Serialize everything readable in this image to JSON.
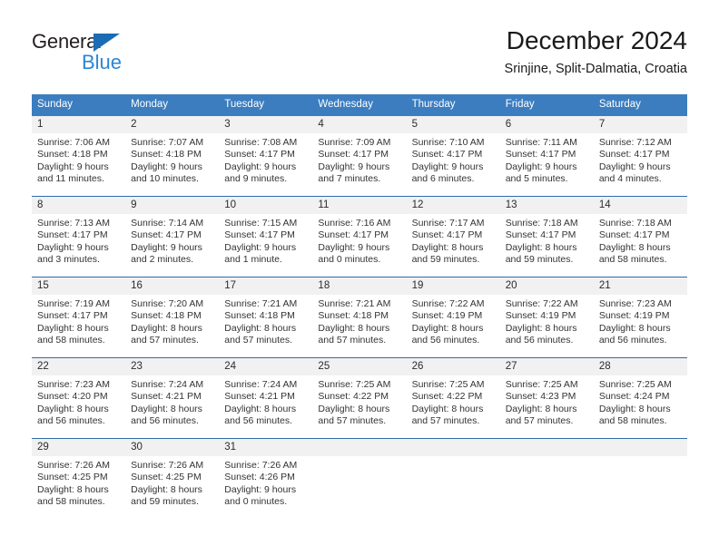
{
  "brand": {
    "name_part1": "General",
    "name_part2": "Blue",
    "accent_color": "#2986d6",
    "triangle_color": "#1b6cb5"
  },
  "header": {
    "title": "December 2024",
    "subtitle": "Srinjine, Split-Dalmatia, Croatia"
  },
  "theme": {
    "header_blue": "#3b7dbf",
    "separator_blue": "#2f6ca8",
    "day_band_gray": "#f1f1f1"
  },
  "weekdays": [
    {
      "label": "Sunday"
    },
    {
      "label": "Monday"
    },
    {
      "label": "Tuesday"
    },
    {
      "label": "Wednesday"
    },
    {
      "label": "Thursday"
    },
    {
      "label": "Friday"
    },
    {
      "label": "Saturday"
    }
  ],
  "weeks": [
    [
      {
        "day": "1",
        "sunrise": "Sunrise: 7:06 AM",
        "sunset": "Sunset: 4:18 PM",
        "daylight1": "Daylight: 9 hours",
        "daylight2": "and 11 minutes."
      },
      {
        "day": "2",
        "sunrise": "Sunrise: 7:07 AM",
        "sunset": "Sunset: 4:18 PM",
        "daylight1": "Daylight: 9 hours",
        "daylight2": "and 10 minutes."
      },
      {
        "day": "3",
        "sunrise": "Sunrise: 7:08 AM",
        "sunset": "Sunset: 4:17 PM",
        "daylight1": "Daylight: 9 hours",
        "daylight2": "and 9 minutes."
      },
      {
        "day": "4",
        "sunrise": "Sunrise: 7:09 AM",
        "sunset": "Sunset: 4:17 PM",
        "daylight1": "Daylight: 9 hours",
        "daylight2": "and 7 minutes."
      },
      {
        "day": "5",
        "sunrise": "Sunrise: 7:10 AM",
        "sunset": "Sunset: 4:17 PM",
        "daylight1": "Daylight: 9 hours",
        "daylight2": "and 6 minutes."
      },
      {
        "day": "6",
        "sunrise": "Sunrise: 7:11 AM",
        "sunset": "Sunset: 4:17 PM",
        "daylight1": "Daylight: 9 hours",
        "daylight2": "and 5 minutes."
      },
      {
        "day": "7",
        "sunrise": "Sunrise: 7:12 AM",
        "sunset": "Sunset: 4:17 PM",
        "daylight1": "Daylight: 9 hours",
        "daylight2": "and 4 minutes."
      }
    ],
    [
      {
        "day": "8",
        "sunrise": "Sunrise: 7:13 AM",
        "sunset": "Sunset: 4:17 PM",
        "daylight1": "Daylight: 9 hours",
        "daylight2": "and 3 minutes."
      },
      {
        "day": "9",
        "sunrise": "Sunrise: 7:14 AM",
        "sunset": "Sunset: 4:17 PM",
        "daylight1": "Daylight: 9 hours",
        "daylight2": "and 2 minutes."
      },
      {
        "day": "10",
        "sunrise": "Sunrise: 7:15 AM",
        "sunset": "Sunset: 4:17 PM",
        "daylight1": "Daylight: 9 hours",
        "daylight2": "and 1 minute."
      },
      {
        "day": "11",
        "sunrise": "Sunrise: 7:16 AM",
        "sunset": "Sunset: 4:17 PM",
        "daylight1": "Daylight: 9 hours",
        "daylight2": "and 0 minutes."
      },
      {
        "day": "12",
        "sunrise": "Sunrise: 7:17 AM",
        "sunset": "Sunset: 4:17 PM",
        "daylight1": "Daylight: 8 hours",
        "daylight2": "and 59 minutes."
      },
      {
        "day": "13",
        "sunrise": "Sunrise: 7:18 AM",
        "sunset": "Sunset: 4:17 PM",
        "daylight1": "Daylight: 8 hours",
        "daylight2": "and 59 minutes."
      },
      {
        "day": "14",
        "sunrise": "Sunrise: 7:18 AM",
        "sunset": "Sunset: 4:17 PM",
        "daylight1": "Daylight: 8 hours",
        "daylight2": "and 58 minutes."
      }
    ],
    [
      {
        "day": "15",
        "sunrise": "Sunrise: 7:19 AM",
        "sunset": "Sunset: 4:17 PM",
        "daylight1": "Daylight: 8 hours",
        "daylight2": "and 58 minutes."
      },
      {
        "day": "16",
        "sunrise": "Sunrise: 7:20 AM",
        "sunset": "Sunset: 4:18 PM",
        "daylight1": "Daylight: 8 hours",
        "daylight2": "and 57 minutes."
      },
      {
        "day": "17",
        "sunrise": "Sunrise: 7:21 AM",
        "sunset": "Sunset: 4:18 PM",
        "daylight1": "Daylight: 8 hours",
        "daylight2": "and 57 minutes."
      },
      {
        "day": "18",
        "sunrise": "Sunrise: 7:21 AM",
        "sunset": "Sunset: 4:18 PM",
        "daylight1": "Daylight: 8 hours",
        "daylight2": "and 57 minutes."
      },
      {
        "day": "19",
        "sunrise": "Sunrise: 7:22 AM",
        "sunset": "Sunset: 4:19 PM",
        "daylight1": "Daylight: 8 hours",
        "daylight2": "and 56 minutes."
      },
      {
        "day": "20",
        "sunrise": "Sunrise: 7:22 AM",
        "sunset": "Sunset: 4:19 PM",
        "daylight1": "Daylight: 8 hours",
        "daylight2": "and 56 minutes."
      },
      {
        "day": "21",
        "sunrise": "Sunrise: 7:23 AM",
        "sunset": "Sunset: 4:19 PM",
        "daylight1": "Daylight: 8 hours",
        "daylight2": "and 56 minutes."
      }
    ],
    [
      {
        "day": "22",
        "sunrise": "Sunrise: 7:23 AM",
        "sunset": "Sunset: 4:20 PM",
        "daylight1": "Daylight: 8 hours",
        "daylight2": "and 56 minutes."
      },
      {
        "day": "23",
        "sunrise": "Sunrise: 7:24 AM",
        "sunset": "Sunset: 4:21 PM",
        "daylight1": "Daylight: 8 hours",
        "daylight2": "and 56 minutes."
      },
      {
        "day": "24",
        "sunrise": "Sunrise: 7:24 AM",
        "sunset": "Sunset: 4:21 PM",
        "daylight1": "Daylight: 8 hours",
        "daylight2": "and 56 minutes."
      },
      {
        "day": "25",
        "sunrise": "Sunrise: 7:25 AM",
        "sunset": "Sunset: 4:22 PM",
        "daylight1": "Daylight: 8 hours",
        "daylight2": "and 57 minutes."
      },
      {
        "day": "26",
        "sunrise": "Sunrise: 7:25 AM",
        "sunset": "Sunset: 4:22 PM",
        "daylight1": "Daylight: 8 hours",
        "daylight2": "and 57 minutes."
      },
      {
        "day": "27",
        "sunrise": "Sunrise: 7:25 AM",
        "sunset": "Sunset: 4:23 PM",
        "daylight1": "Daylight: 8 hours",
        "daylight2": "and 57 minutes."
      },
      {
        "day": "28",
        "sunrise": "Sunrise: 7:25 AM",
        "sunset": "Sunset: 4:24 PM",
        "daylight1": "Daylight: 8 hours",
        "daylight2": "and 58 minutes."
      }
    ],
    [
      {
        "day": "29",
        "sunrise": "Sunrise: 7:26 AM",
        "sunset": "Sunset: 4:25 PM",
        "daylight1": "Daylight: 8 hours",
        "daylight2": "and 58 minutes."
      },
      {
        "day": "30",
        "sunrise": "Sunrise: 7:26 AM",
        "sunset": "Sunset: 4:25 PM",
        "daylight1": "Daylight: 8 hours",
        "daylight2": "and 59 minutes."
      },
      {
        "day": "31",
        "sunrise": "Sunrise: 7:26 AM",
        "sunset": "Sunset: 4:26 PM",
        "daylight1": "Daylight: 9 hours",
        "daylight2": "and 0 minutes."
      },
      {
        "day": "",
        "sunrise": "",
        "sunset": "",
        "daylight1": "",
        "daylight2": ""
      },
      {
        "day": "",
        "sunrise": "",
        "sunset": "",
        "daylight1": "",
        "daylight2": ""
      },
      {
        "day": "",
        "sunrise": "",
        "sunset": "",
        "daylight1": "",
        "daylight2": ""
      },
      {
        "day": "",
        "sunrise": "",
        "sunset": "",
        "daylight1": "",
        "daylight2": ""
      }
    ]
  ]
}
